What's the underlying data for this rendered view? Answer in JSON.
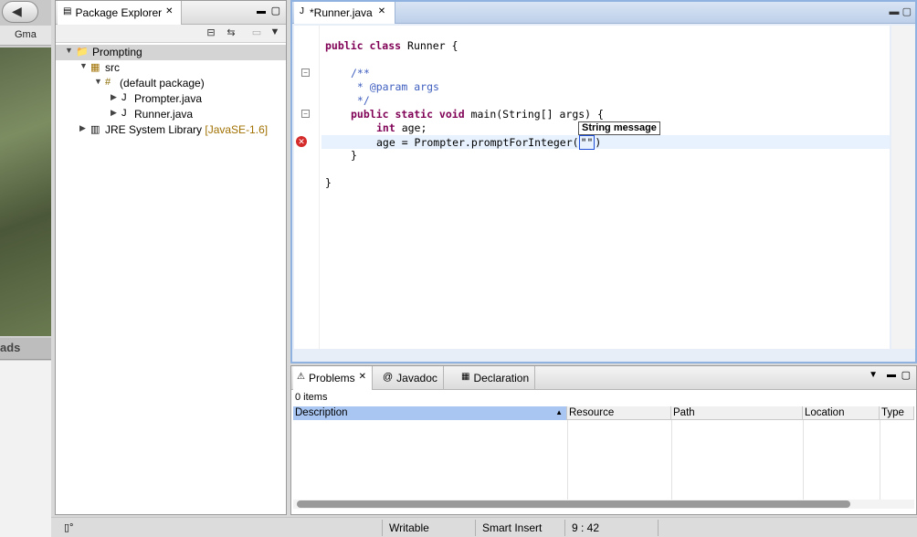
{
  "background": {
    "tab_label": "Gma",
    "side_label": "ads"
  },
  "package_explorer": {
    "title": "Package Explorer",
    "tree": {
      "project": "Prompting",
      "src": "src",
      "package": "(default package)",
      "files": [
        "Prompter.java",
        "Runner.java"
      ],
      "library": "JRE System Library",
      "library_decoration": "[JavaSE-1.6]"
    }
  },
  "editor": {
    "tab_title": "*Runner.java",
    "tooltip": "String message",
    "code": {
      "l1_kw": "public class",
      "l1_rest": " Runner {",
      "l2": "/**",
      "l3": " * @param args",
      "l4": " */",
      "l5_kw": "public static void",
      "l5_rest": " main(String[] args) {",
      "l6_kw": "int",
      "l6_rest": " age;",
      "l7_a": "age = Prompter.promptForInteger(",
      "l7_b": "\"\"",
      "l7_c": ")",
      "l8": "}",
      "l9": "}"
    }
  },
  "problems_view": {
    "tabs": [
      "Problems",
      "Javadoc",
      "Declaration"
    ],
    "items_count": "0 items",
    "columns": [
      "Description",
      "Resource",
      "Path",
      "Location",
      "Type"
    ]
  },
  "status_bar": {
    "writable": "Writable",
    "insert_mode": "Smart Insert",
    "position": "9 : 42"
  }
}
